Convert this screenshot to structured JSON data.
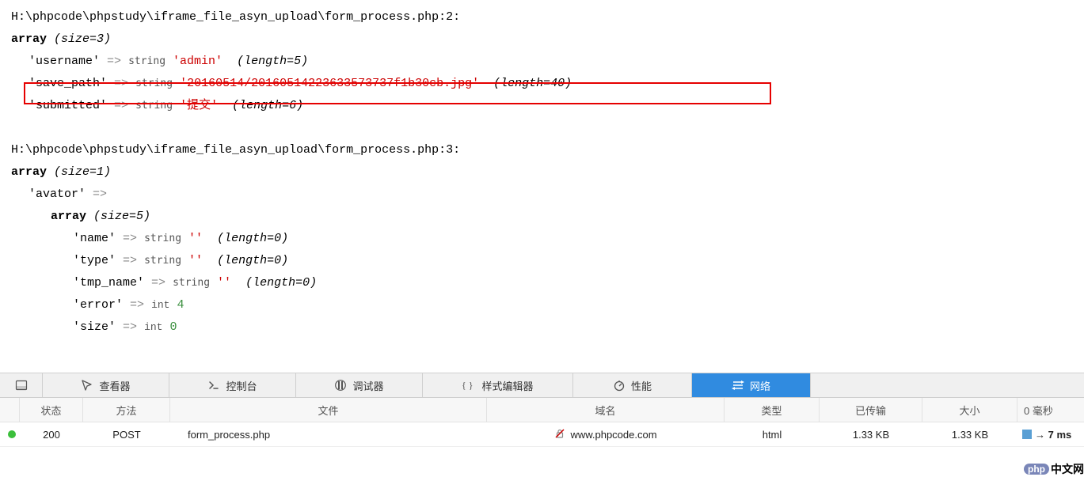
{
  "dump1": {
    "path": "H:\\phpcode\\phpstudy\\iframe_file_asyn_upload\\form_process.php:2:",
    "array_label": "array",
    "size_label": "(size=3)",
    "rows": {
      "username": {
        "key": "'username'",
        "arrow": "=>",
        "type": "string",
        "value": "'admin'",
        "len": "(length=5)"
      },
      "save_path": {
        "key": "'save_path'",
        "arrow": "=>",
        "type": "string",
        "value": "'20160514/20160514223633573737f1b30cb.jpg'",
        "len": "(length=40)"
      },
      "submitted": {
        "key": "'submitted'",
        "arrow": "=>",
        "type": "string",
        "value": "'提交'",
        "len": "(length=6)"
      }
    }
  },
  "dump2": {
    "path": "H:\\phpcode\\phpstudy\\iframe_file_asyn_upload\\form_process.php:3:",
    "array_label": "array",
    "size_label": "(size=1)",
    "key_avator": "'avator'",
    "arrow": "=>",
    "inner_array_label": "array",
    "inner_size_label": "(size=5)",
    "rows": {
      "name": {
        "key": "'name'",
        "arrow": "=>",
        "type": "string",
        "value": "''",
        "len": "(length=0)"
      },
      "type": {
        "key": "'type'",
        "arrow": "=>",
        "type": "string",
        "value": "''",
        "len": "(length=0)"
      },
      "tmp_name": {
        "key": "'tmp_name'",
        "arrow": "=>",
        "type": "string",
        "value": "''",
        "len": "(length=0)"
      },
      "error": {
        "key": "'error'",
        "arrow": "=>",
        "type": "int",
        "value": "4"
      },
      "size": {
        "key": "'size'",
        "arrow": "=>",
        "type": "int",
        "value": "0"
      }
    }
  },
  "devtools": {
    "tabs": {
      "inspector": "查看器",
      "console": "控制台",
      "debugger": "调试器",
      "style": "样式编辑器",
      "perf": "性能",
      "network": "网络"
    }
  },
  "net_header": {
    "status": "状态",
    "method": "方法",
    "file": "文件",
    "domain": "域名",
    "type": "类型",
    "transferred": "已传输",
    "size": "大小",
    "timeline": "0 毫秒"
  },
  "net_row": {
    "status": "200",
    "method": "POST",
    "file": "form_process.php",
    "domain": "www.phpcode.com",
    "type": "html",
    "transferred": "1.33 KB",
    "size": "1.33 KB",
    "time": "→ 7 ms"
  },
  "watermark": {
    "badge": "php",
    "text": "中文网"
  }
}
